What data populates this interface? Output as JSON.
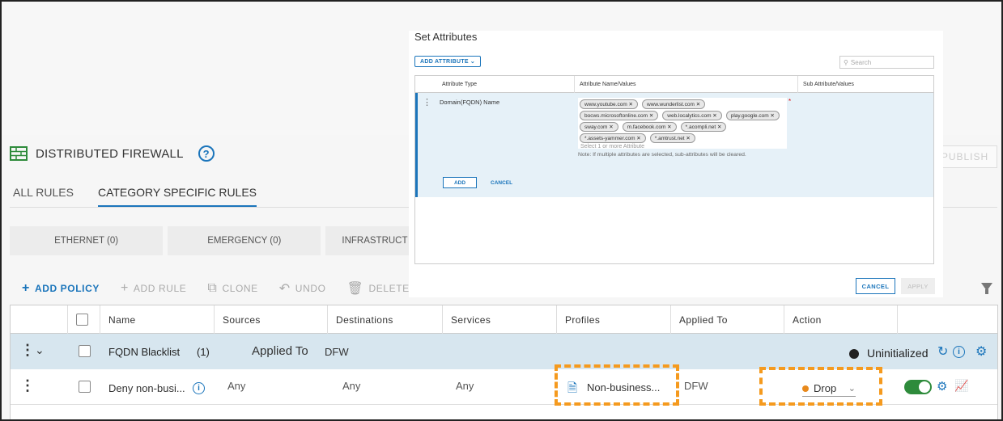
{
  "header": {
    "title": "DISTRIBUTED FIREWALL",
    "help": "?",
    "publish": "PUBLISH"
  },
  "tabs": [
    {
      "label": "ALL RULES",
      "active": false
    },
    {
      "label": "CATEGORY SPECIFIC RULES",
      "active": true
    }
  ],
  "categories": [
    "ETHERNET (0)",
    "EMERGENCY (0)",
    "INFRASTRUCT"
  ],
  "toolbar": {
    "add_policy": "ADD POLICY",
    "add_rule": "ADD RULE",
    "clone": "CLONE",
    "undo": "UNDO",
    "delete": "DELETE"
  },
  "table": {
    "columns": [
      "Name",
      "Sources",
      "Destinations",
      "Services",
      "Profiles",
      "Applied To",
      "Action"
    ],
    "policy": {
      "name": "FQDN Blacklist",
      "count": "(1)",
      "applied_to_label": "Applied To",
      "applied_to": "DFW",
      "status": "Uninitialized"
    },
    "rule": {
      "name": "Deny non-busi...",
      "sources": "Any",
      "destinations": "Any",
      "services": "Any",
      "profiles": "Non-business...",
      "applied_to": "DFW",
      "action": "Drop"
    }
  },
  "modal": {
    "title": "Set Attributes",
    "add_attribute": "ADD ATTRIBUTE",
    "search_placeholder": "Search",
    "columns": [
      "Attribute Type",
      "Attribute Name/Values",
      "Sub Attribute/Values"
    ],
    "row": {
      "type": "Domain(FQDN) Name",
      "values": [
        "www.youtube.com",
        "www.wunderlist.com",
        "bocws.microsoftonline.com",
        "web.localytics.com",
        "play.google.com",
        "sway.com",
        "m.facebook.com",
        "*.acompli.net",
        "*.assets-yammer.com",
        "*.amtrust.net"
      ],
      "placeholder": "Select 1 or more Attribute",
      "note": "Note: If multiple attributes are selected, sub-attributes will be cleared.",
      "required_mark": "*"
    },
    "row_add": "ADD",
    "row_cancel": "CANCEL",
    "cancel": "CANCEL",
    "apply": "APPLY"
  },
  "colors": {
    "accent": "#1b75bb",
    "highlight": "#f59a1e",
    "toggle_on": "#2e8b3b"
  }
}
